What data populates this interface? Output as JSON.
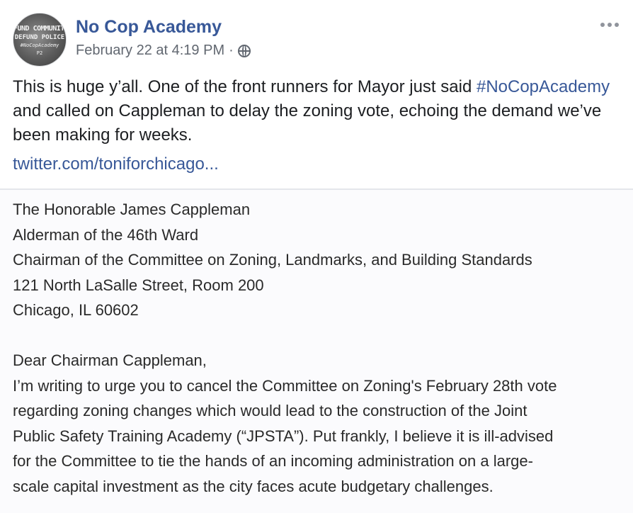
{
  "post": {
    "page_name": "No Cop Academy",
    "timestamp": "February 22 at 4:19 PM",
    "separator": "·",
    "audience_icon": "globe-icon",
    "more_icon": "ellipsis-icon",
    "avatar_text": [
      "FUND COMMUNITIE",
      "DEFUND POLICE",
      "#NoCopAcademy",
      "P2"
    ],
    "text_before": "This is huge y’all. One of the front runners for Mayor just said ",
    "hashtag": "#NoCopAcademy",
    "text_after": " and called on Cappleman to delay the zoning vote, echoing the demand we’ve been making for weeks.",
    "link": "twitter.com/toniforchicago..."
  },
  "attachment": {
    "address": [
      "The Honorable James Cappleman",
      "Alderman of the 46th Ward",
      "Chairman of the Committee on Zoning, Landmarks, and Building Standards",
      "121 North LaSalle Street, Room 200",
      "Chicago, IL 60602"
    ],
    "salutation": "Dear Chairman Cappleman,",
    "body": [
      "I’m writing to urge you to cancel the Committee on Zoning's February 28th vote",
      "regarding zoning changes which would lead to the construction of the Joint",
      "Public Safety Training Academy (“JPSTA”). Put frankly, I believe it is ill-advised",
      "for the Committee to tie the hands of an incoming administration on a large-",
      "scale capital investment as the city faces acute budgetary challenges."
    ]
  }
}
